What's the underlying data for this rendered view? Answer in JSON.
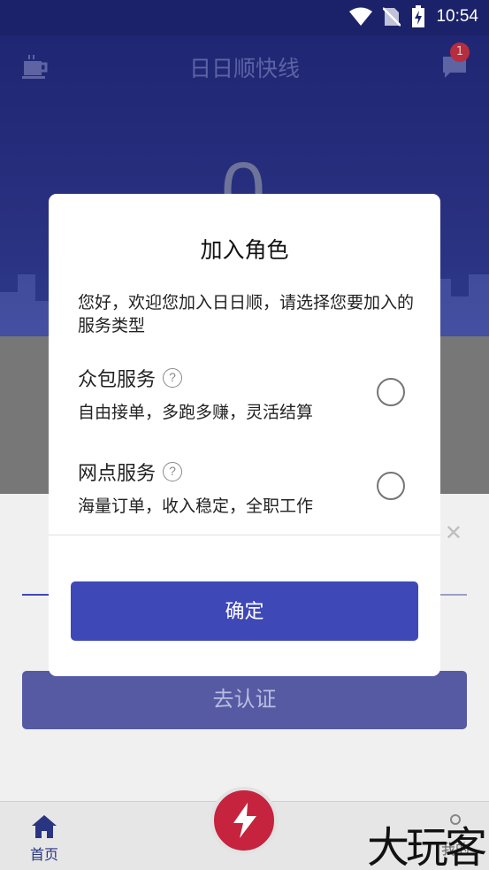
{
  "status_bar": {
    "time": "10:54"
  },
  "header": {
    "title": "日日顺快线",
    "badge_count": "1"
  },
  "hero": {
    "value": "0"
  },
  "lower": {
    "verify_label": "去认证"
  },
  "tabbar": {
    "home_label": "首页",
    "mine_label": "我的"
  },
  "watermark": "大玩客",
  "dialog": {
    "title": "加入角色",
    "description": "您好，欢迎您加入日日顺，请选择您要加入的服务类型",
    "options": [
      {
        "title": "众包服务",
        "subtitle": "自由接单，多跑多赚，灵活结算",
        "help": "?"
      },
      {
        "title": "网点服务",
        "subtitle": "海量订单，收入稳定，全职工作",
        "help": "?"
      }
    ],
    "confirm_label": "确定"
  },
  "colors": {
    "accent": "#3f48b7",
    "header_bg": "#1f2774",
    "center_button": "#c5233e"
  }
}
